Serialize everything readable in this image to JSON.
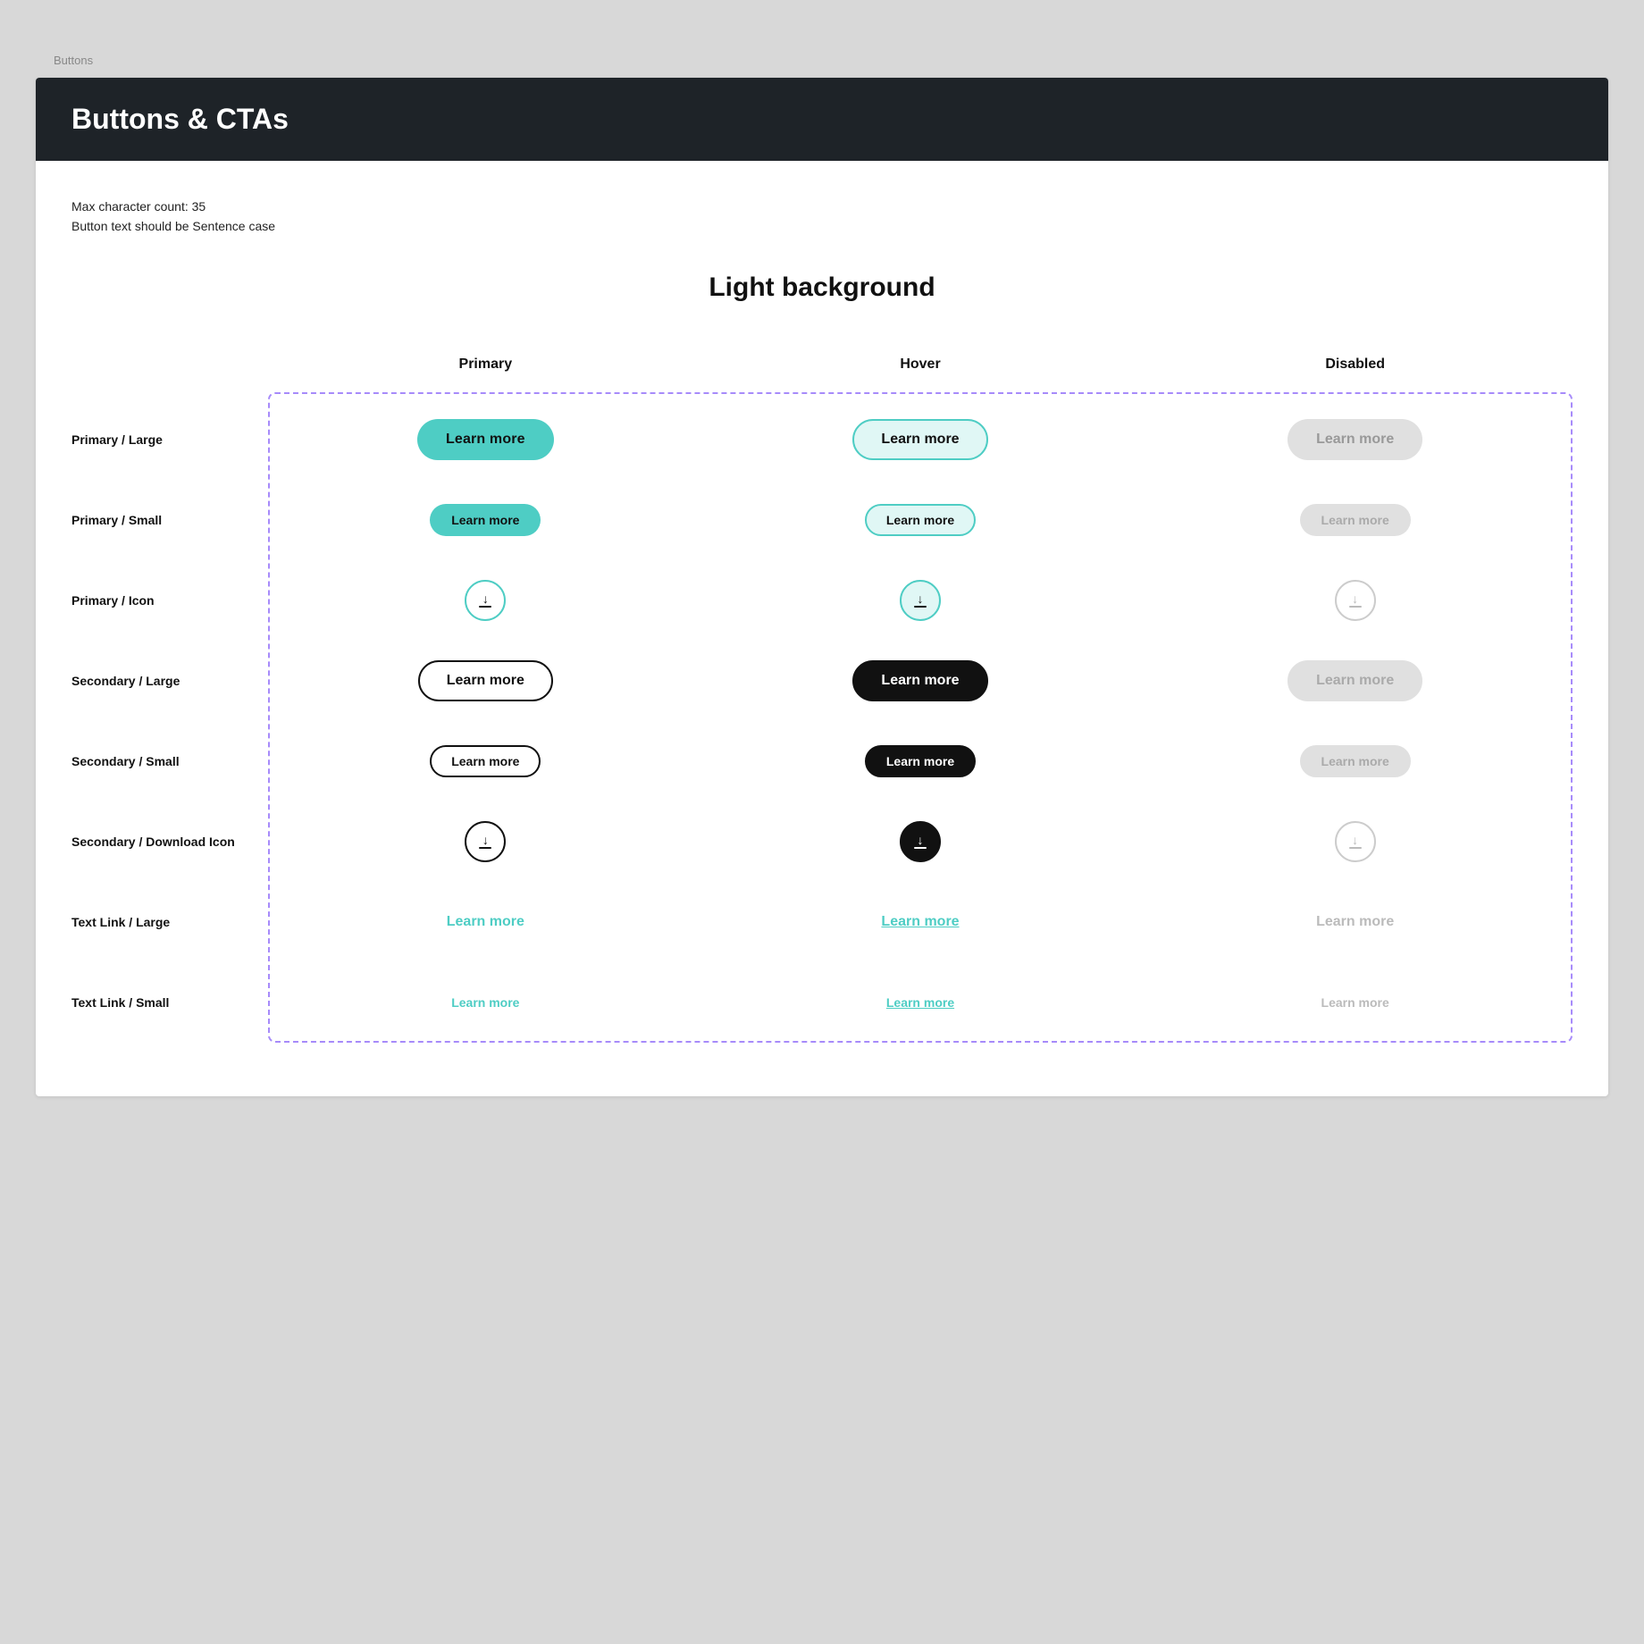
{
  "breadcrumb": "Buttons",
  "page": {
    "title": "Buttons & CTAs",
    "meta_line1": "Max character count: 35",
    "meta_line2": "Button text should be Sentence case",
    "section_title": "Light background",
    "columns": {
      "primary": "Primary",
      "hover": "Hover",
      "disabled": "Disabled"
    },
    "rows": [
      {
        "id": "primary-large",
        "label": "Primary / Large",
        "primary_text": "Learn more",
        "hover_text": "Learn more",
        "disabled_text": "Learn more",
        "type": "pill-large",
        "variant": "primary"
      },
      {
        "id": "primary-small",
        "label": "Primary / Small",
        "primary_text": "Learn more",
        "hover_text": "Learn more",
        "disabled_text": "Learn more",
        "type": "pill-small",
        "variant": "primary"
      },
      {
        "id": "primary-icon",
        "label": "Primary / Icon",
        "type": "icon",
        "variant": "primary"
      },
      {
        "id": "secondary-large",
        "label": "Secondary / Large",
        "primary_text": "Learn more",
        "hover_text": "Learn more",
        "disabled_text": "Learn more",
        "type": "pill-large",
        "variant": "secondary"
      },
      {
        "id": "secondary-small",
        "label": "Secondary / Small",
        "primary_text": "Learn more",
        "hover_text": "Learn more",
        "disabled_text": "Learn more",
        "type": "pill-small",
        "variant": "secondary"
      },
      {
        "id": "secondary-download",
        "label": "Secondary / Download Icon",
        "type": "dl-icon",
        "variant": "secondary"
      },
      {
        "id": "text-large",
        "label": "Text Link / Large",
        "primary_text": "Learn more",
        "hover_text": "Learn more",
        "disabled_text": "Learn more",
        "type": "text-large",
        "variant": "text"
      },
      {
        "id": "text-small",
        "label": "Text Link / Small",
        "primary_text": "Learn more",
        "hover_text": "Learn more",
        "disabled_text": "Learn more",
        "type": "text-small",
        "variant": "text"
      }
    ]
  }
}
